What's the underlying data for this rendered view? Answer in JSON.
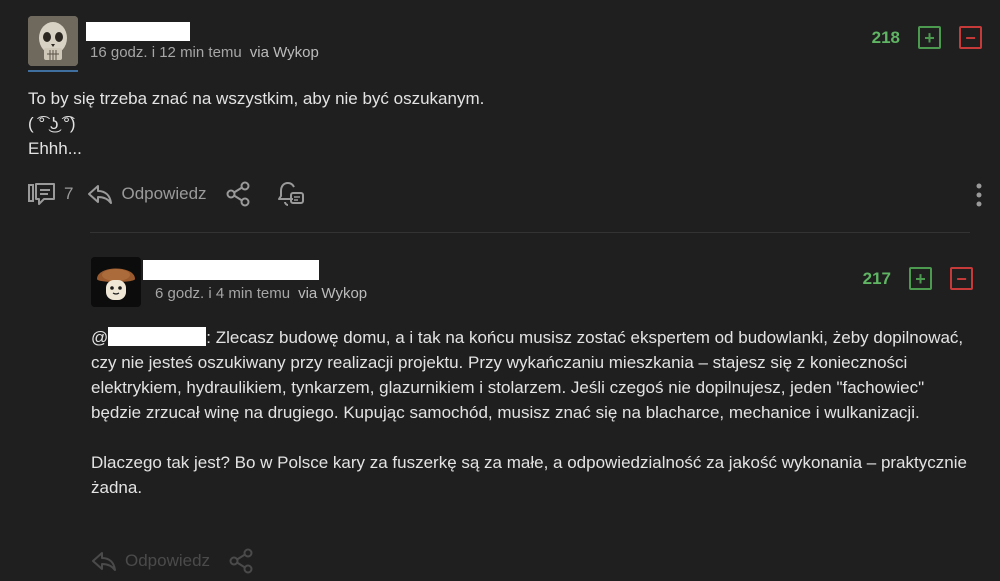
{
  "comment1": {
    "time": "16 godz. i 12 min temu",
    "via": "via Wykop",
    "votes": "218",
    "lines": [
      "To by się trzeba znać na wszystkim, aby nie być oszukanym.",
      "( ͡° ͜ʖ ͡°)",
      "Ehhh..."
    ],
    "replies_count": "7",
    "reply_label": "Odpowiedz"
  },
  "comment2": {
    "time": "6 godz. i 4 min temu",
    "via": "via Wykop",
    "votes": "217",
    "mention_prefix": "@",
    "paragraph1_rest": ": Zlecasz budowę domu, a i tak na końcu musisz zostać ekspertem od budowlanki, żeby dopilnować, czy nie jesteś oszukiwany przy realizacji projektu. Przy wykańczaniu mieszkania – stajesz się z konieczności elektrykiem, hydraulikiem, tynkarzem, glazurnikiem i stolarzem. Jeśli czegoś nie dopilnujesz, jeden \"fachowiec\" będzie zrzucał winę na drugiego. Kupując samochód, musisz znać się na blacharce, mechanice i wulkanizacji.",
    "paragraph2": "Dlaczego tak jest? Bo w Polsce kary za fuszerkę są za małe, a odpowiedzialność za jakość wykonania – praktycznie żadna.",
    "reply_label": "Odpowiedz"
  },
  "icons": {
    "plus": "+",
    "minus": "−"
  }
}
